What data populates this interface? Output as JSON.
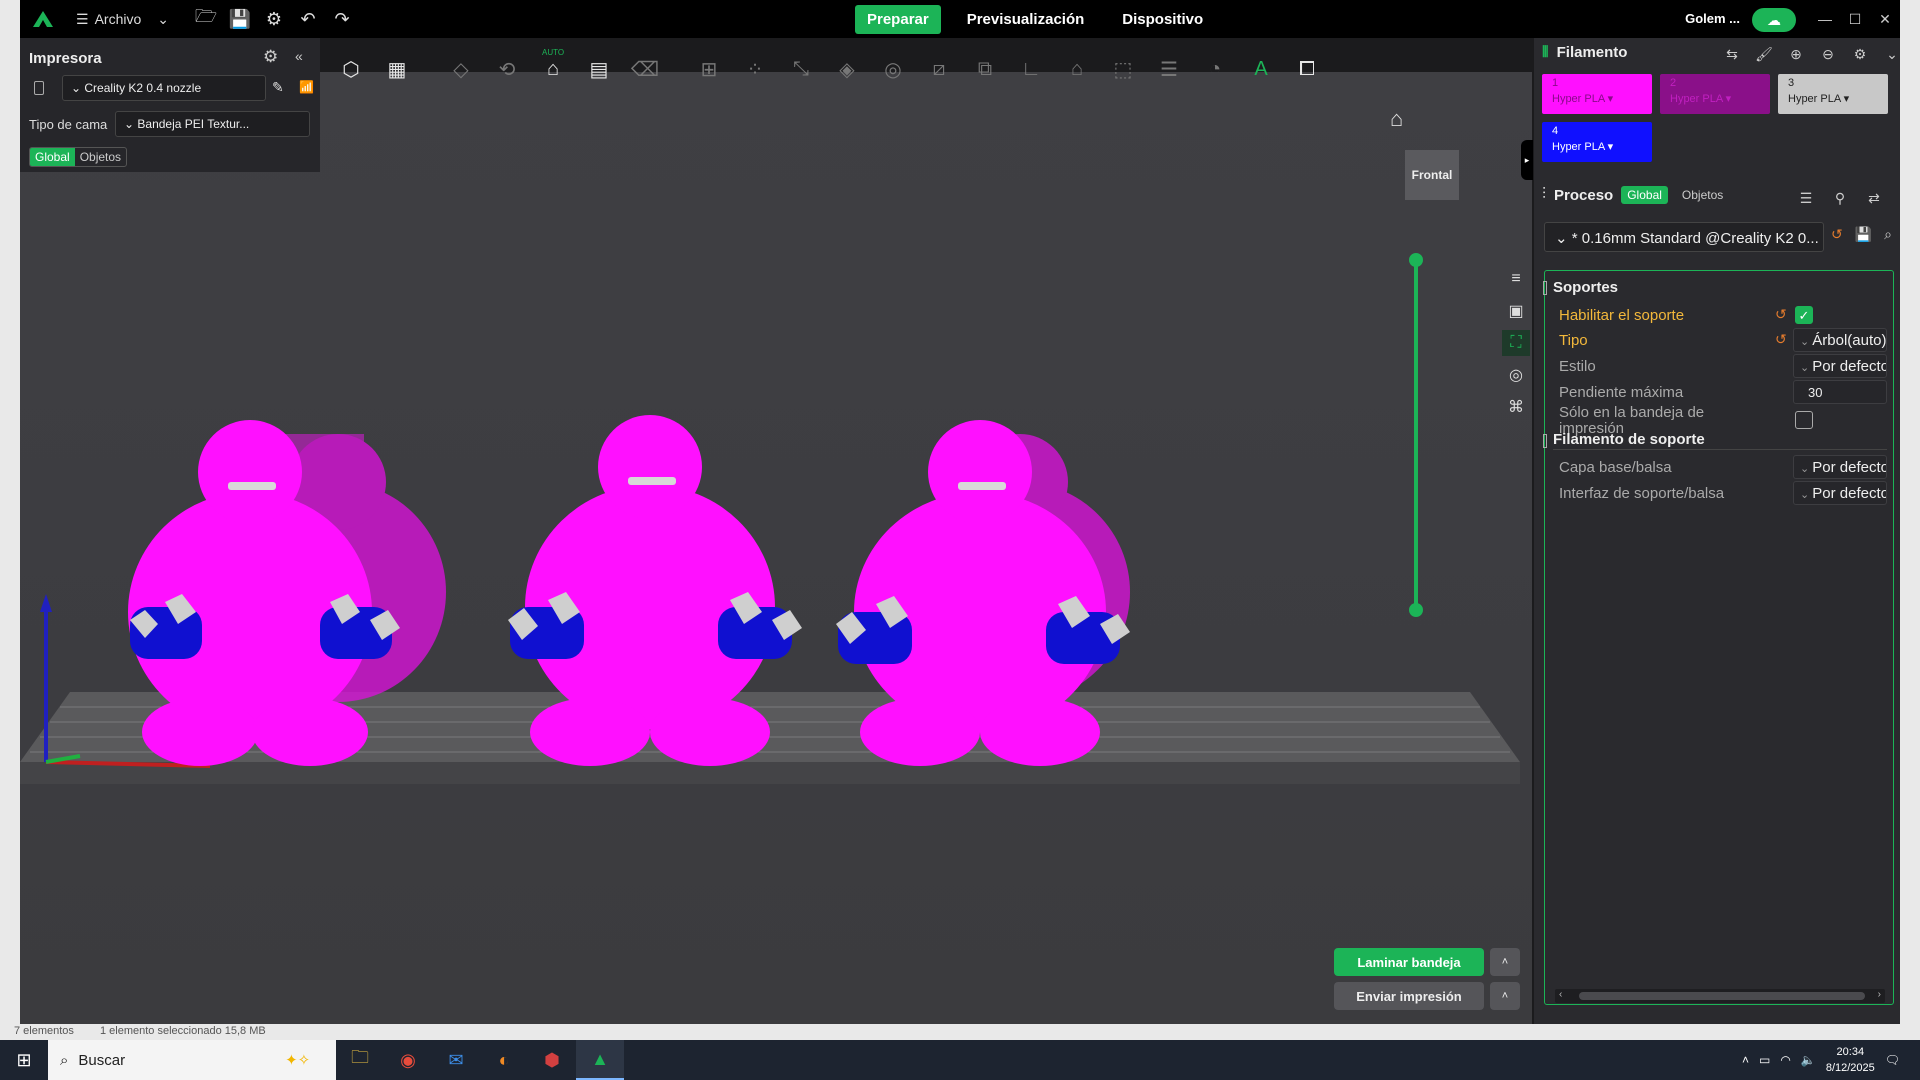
{
  "titlebar": {
    "menu_label": "Archivo",
    "tabs": [
      "Preparar",
      "Previsualización",
      "Dispositivo"
    ],
    "active_tab": "Preparar",
    "account": "Golem ..."
  },
  "printer": {
    "title": "Impresora",
    "model": "Creality K2 0.4 nozzle",
    "bed_label": "Tipo de cama",
    "bed_value": "Bandeja PEI Textur...",
    "scope_global": "Global",
    "scope_objects": "Objetos"
  },
  "toolbar": {
    "auto_label": "AUTO"
  },
  "viewport": {
    "view_label": "Frontal",
    "slice_button": "Laminar bandeja",
    "send_button": "Enviar impresión"
  },
  "filament": {
    "title": "Filamento",
    "slots": [
      {
        "num": "1",
        "material": "Hyper PLA",
        "color": "#ff10ff"
      },
      {
        "num": "2",
        "material": "Hyper PLA",
        "color": "#8a1089"
      },
      {
        "num": "3",
        "material": "Hyper PLA",
        "color": "#c8c8c8"
      },
      {
        "num": "4",
        "material": "Hyper PLA",
        "color": "#1010ff"
      }
    ]
  },
  "process": {
    "title": "Proceso",
    "scope_global": "Global",
    "scope_objects": "Objetos",
    "profile": "* 0.16mm Standard @Creality K2 0..."
  },
  "supports": {
    "section": "Soportes",
    "enable_label": "Habilitar el soporte",
    "type_label": "Tipo",
    "type_value": "Árbol(auto)",
    "style_label": "Estilo",
    "style_value": "Por defecto",
    "slope_label": "Pendiente máxima",
    "slope_value": "30",
    "bed_only_label": "Sólo en la bandeja de impresión",
    "filament_section": "Filamento de soporte",
    "base_label": "Capa base/balsa",
    "base_value": "Por defecto",
    "interface_label": "Interfaz de soporte/balsa",
    "interface_value": "Por defecto"
  },
  "status": {
    "count": "7 elementos",
    "selected": "1 elemento seleccionado  15,8 MB"
  },
  "taskbar": {
    "search": "Buscar",
    "time": "20:34",
    "date": "8/12/2025"
  },
  "colors": {
    "accent": "#1cb457",
    "model_magenta": "#ff10ff",
    "model_blue": "#1010d0",
    "modified_label": "#f3b83b"
  }
}
